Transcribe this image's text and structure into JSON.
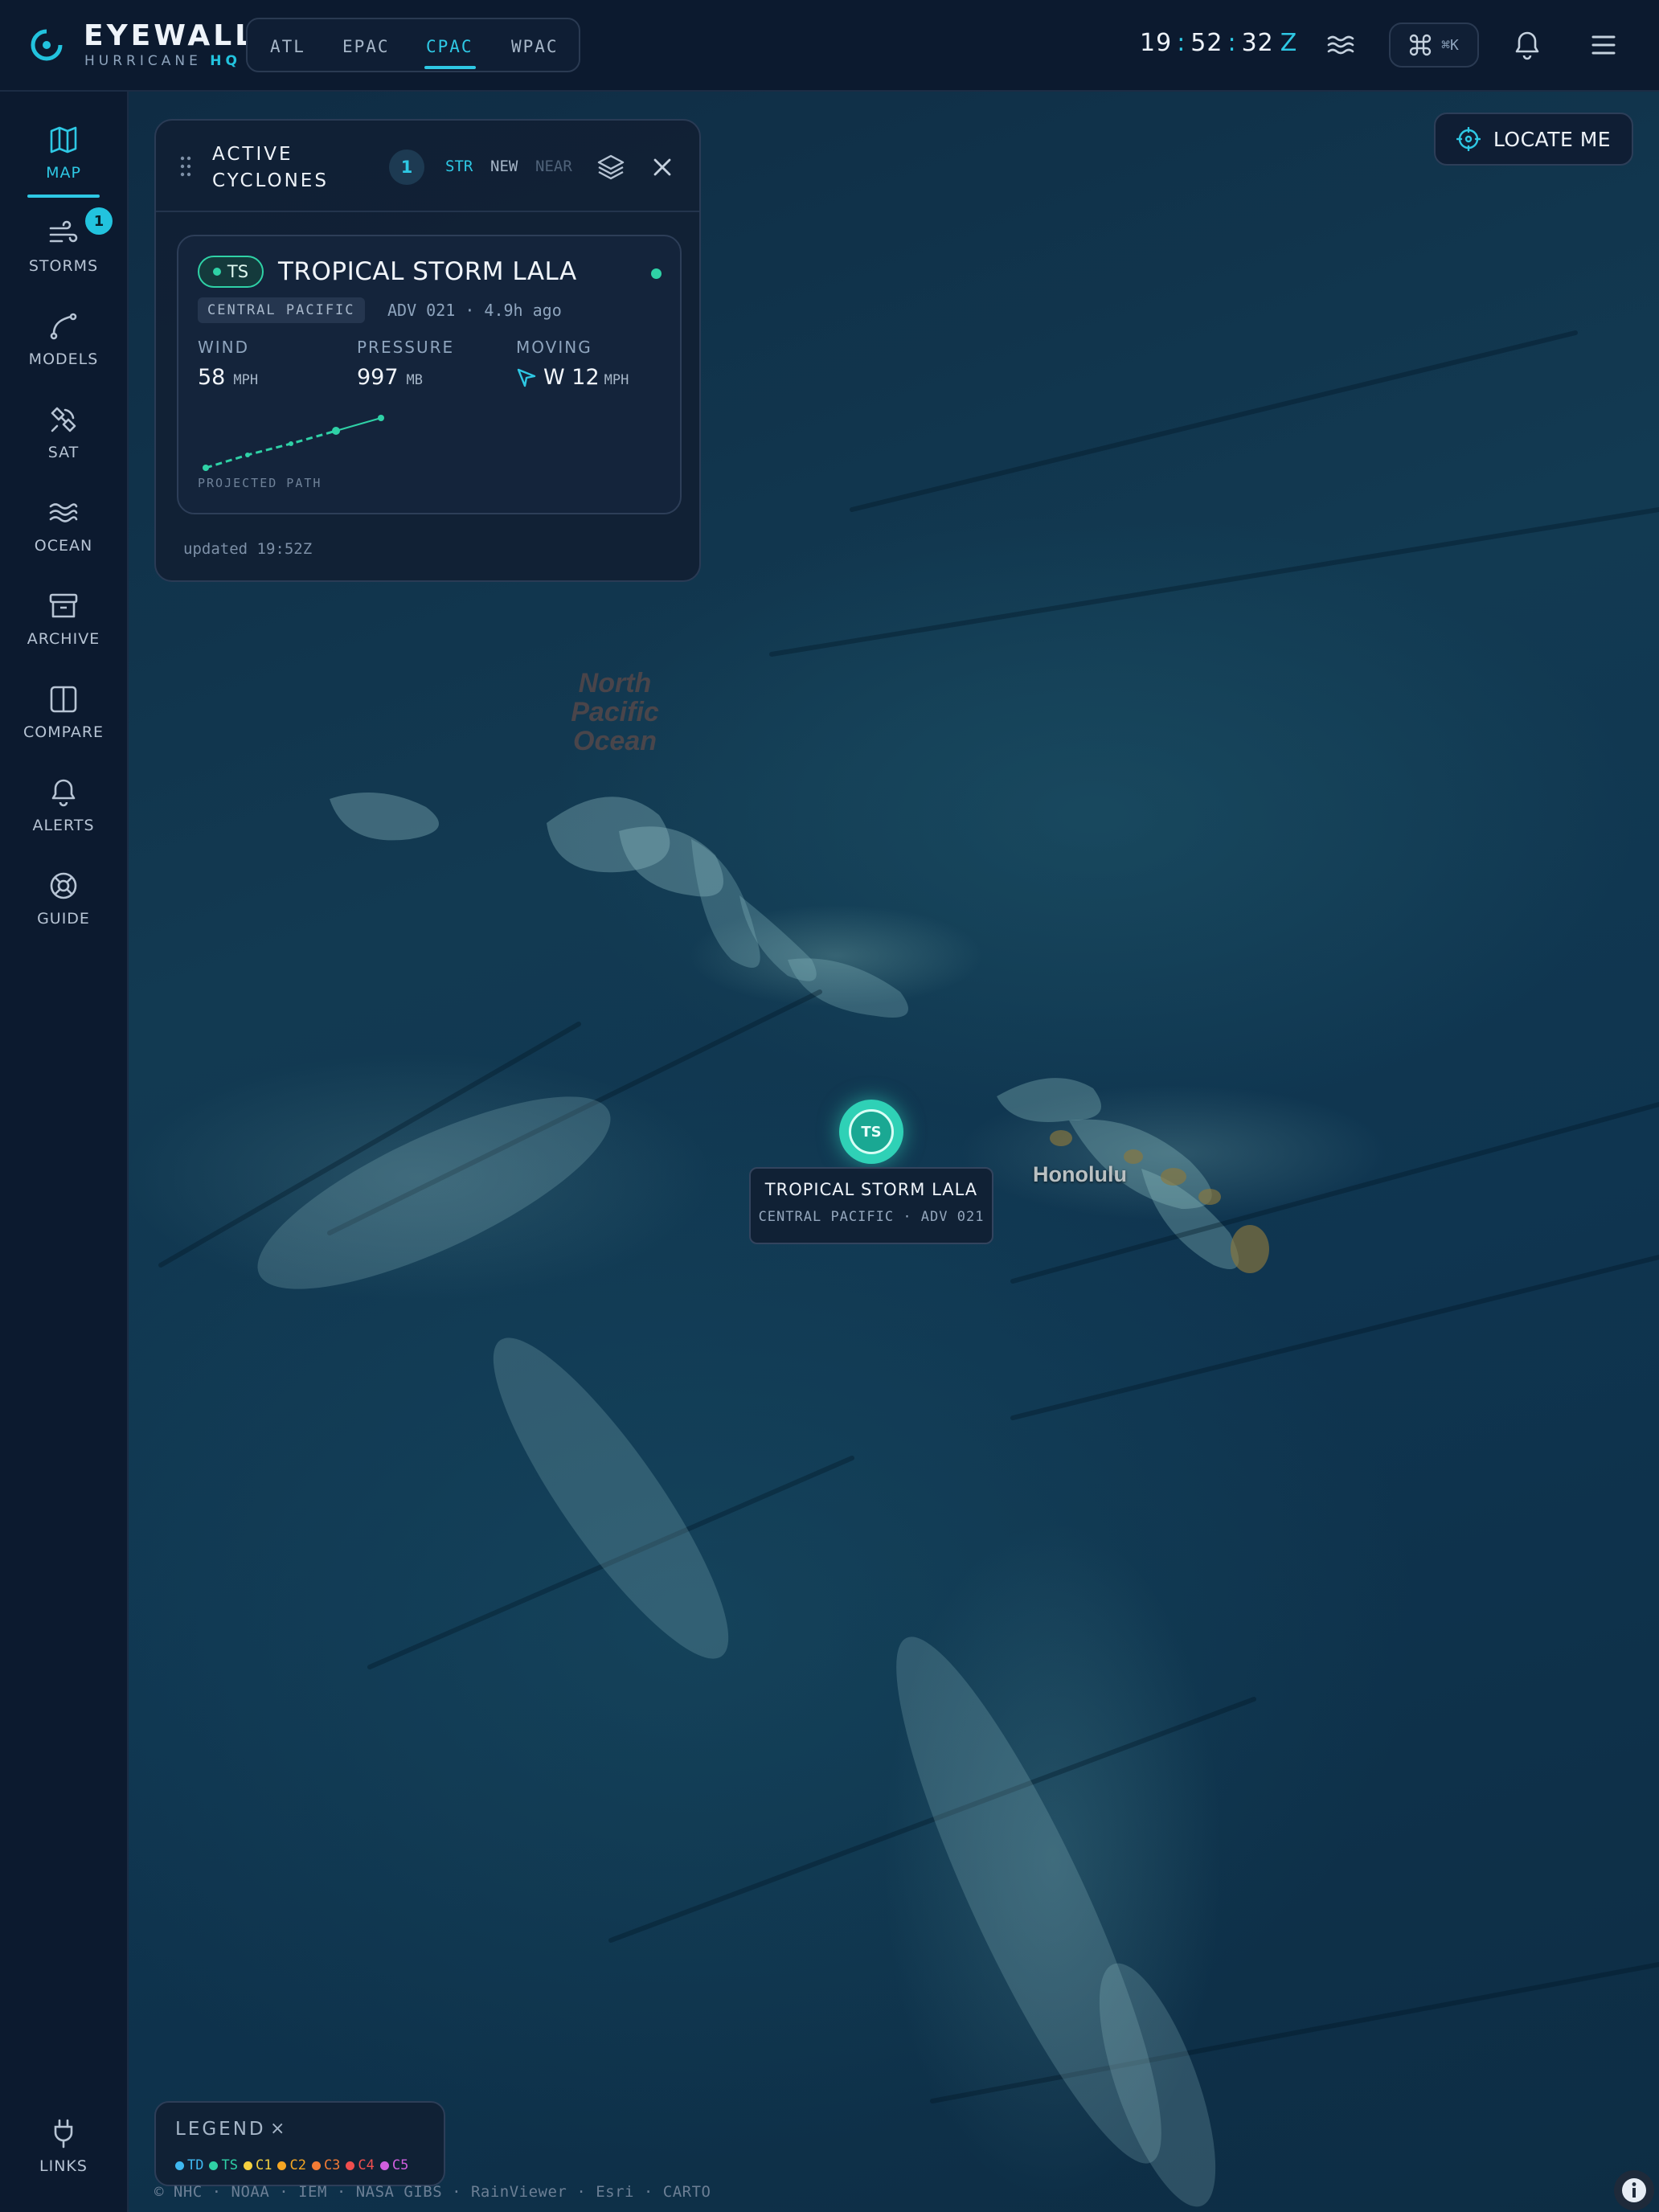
{
  "brand": {
    "title": "EYEWALL",
    "subtitle_prefix": "HURRICANE",
    "subtitle_suffix": "HQ"
  },
  "basins": [
    {
      "label": "ATL",
      "active": false
    },
    {
      "label": "EPAC",
      "active": false
    },
    {
      "label": "CPAC",
      "active": true
    },
    {
      "label": "WPAC",
      "active": false
    }
  ],
  "clock": {
    "hh": "19",
    "mm": "52",
    "ss": "32",
    "zone": "Z"
  },
  "shortcut": {
    "key": "⌘K"
  },
  "sidebar": {
    "items": [
      {
        "label": "MAP",
        "icon": "map-icon",
        "active": true
      },
      {
        "label": "STORMS",
        "icon": "wind-icon",
        "badge": "1"
      },
      {
        "label": "MODELS",
        "icon": "spline-icon"
      },
      {
        "label": "SAT",
        "icon": "satellite-icon"
      },
      {
        "label": "OCEAN",
        "icon": "waves-icon"
      },
      {
        "label": "ARCHIVE",
        "icon": "archive-icon"
      },
      {
        "label": "COMPARE",
        "icon": "columns-icon"
      },
      {
        "label": "ALERTS",
        "icon": "bell-icon"
      },
      {
        "label": "GUIDE",
        "icon": "lifebuoy-icon"
      }
    ],
    "bottom": {
      "label": "LINKS",
      "icon": "plug-icon"
    }
  },
  "panel": {
    "title": "ACTIVE CYCLONES",
    "count": "1",
    "sort": {
      "str": "STR",
      "new": "NEW",
      "near": "NEAR"
    },
    "storm": {
      "category": "TS",
      "name": "TROPICAL STORM LALA",
      "region": "CENTRAL PACIFIC",
      "advisory": "ADV 021 · 4.9h ago",
      "wind": {
        "label": "WIND",
        "value": "58",
        "unit": "MPH"
      },
      "pressure": {
        "label": "PRESSURE",
        "value": "997",
        "unit": "MB"
      },
      "moving": {
        "label": "MOVING",
        "value": "W 12",
        "unit": "MPH"
      },
      "path_label": "PROJECTED PATH"
    },
    "updated": "updated 19:52Z"
  },
  "map": {
    "ocean_label": "North\nPacific\nOcean",
    "city_label": "Honolulu",
    "marker": {
      "code": "TS",
      "name": "TROPICAL STORM LALA",
      "sub": "CENTRAL PACIFIC · ADV 021"
    }
  },
  "locate": {
    "label": "LOCATE ME"
  },
  "legend": {
    "title": "LEGEND",
    "close": "×",
    "items": [
      {
        "label": "TD",
        "color": "#3fb8f0"
      },
      {
        "label": "TS",
        "color": "#2fd1a6"
      },
      {
        "label": "C1",
        "color": "#f4d03f"
      },
      {
        "label": "C2",
        "color": "#f5a623"
      },
      {
        "label": "C3",
        "color": "#f27b35"
      },
      {
        "label": "C4",
        "color": "#ef4e4e"
      },
      {
        "label": "C5",
        "color": "#d15fe0"
      }
    ]
  },
  "attribution": "© NHC · NOAA · IEM · NASA GIBS · RainViewer · Esri · CARTO",
  "colors": {
    "accent": "#2ec8e4",
    "ts": "#2fd1a6",
    "bg": "#0c1a2f"
  }
}
